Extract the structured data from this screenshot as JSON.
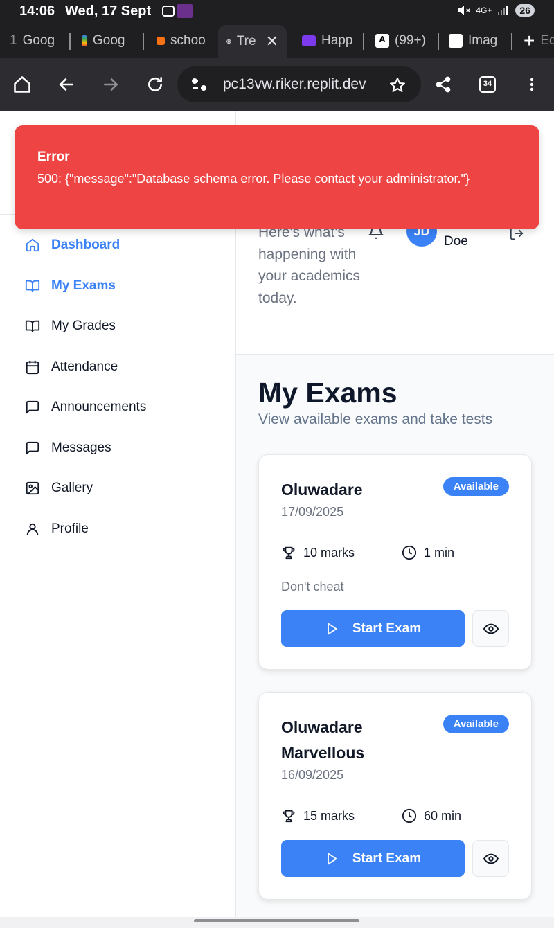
{
  "status_bar": {
    "time": "14:06",
    "date": "Wed, 17 Sept",
    "network": "4G+",
    "battery": "26"
  },
  "tabs": [
    {
      "label": "Goog",
      "active": false
    },
    {
      "label": "Goog",
      "active": false
    },
    {
      "label": "schoo",
      "active": false
    },
    {
      "label": "Tre",
      "active": true
    },
    {
      "label": "Happ",
      "active": false
    },
    {
      "label": "(99+)",
      "active": false
    },
    {
      "label": "Imag",
      "active": false
    },
    {
      "label": "Ed",
      "active": false
    }
  ],
  "toolbar": {
    "url": "pc13vw.riker.replit.dev",
    "tab_count": "34"
  },
  "sidebar": {
    "items": [
      {
        "label": "Dashboard",
        "icon": "home-icon",
        "active": true
      },
      {
        "label": "My Exams",
        "icon": "book-open-icon",
        "active": true
      },
      {
        "label": "My Grades",
        "icon": "book-open-icon",
        "active": false
      },
      {
        "label": "Attendance",
        "icon": "calendar-icon",
        "active": false
      },
      {
        "label": "Announcements",
        "icon": "message-square-icon",
        "active": false
      },
      {
        "label": "Messages",
        "icon": "message-square-icon",
        "active": false
      },
      {
        "label": "Gallery",
        "icon": "image-icon",
        "active": false
      },
      {
        "label": "Profile",
        "icon": "user-icon",
        "active": false
      }
    ]
  },
  "header": {
    "welcome_sub": "Here's what's happening with your academics today.",
    "avatar_initials": "JD",
    "user_last_name": "Doe"
  },
  "exams_page": {
    "title": "My Exams",
    "subtitle": "View available exams and take tests",
    "exams": [
      {
        "title": "Oluwadare",
        "date": "17/09/2025",
        "status": "Available",
        "marks": "10 marks",
        "duration": "1 min",
        "description": "Don't cheat",
        "start_label": "Start Exam"
      },
      {
        "title": "Oluwadare Marvellous",
        "date": "16/09/2025",
        "status": "Available",
        "marks": "15 marks",
        "duration": "60 min",
        "description": "",
        "start_label": "Start Exam"
      }
    ]
  },
  "toast": {
    "title": "Error",
    "message": "500: {\"message\":\"Database schema error. Please contact your administrator.\"}"
  },
  "colors": {
    "accent": "#3b82f6",
    "error": "#ef4444",
    "browser_chrome": "#2d2d31"
  }
}
